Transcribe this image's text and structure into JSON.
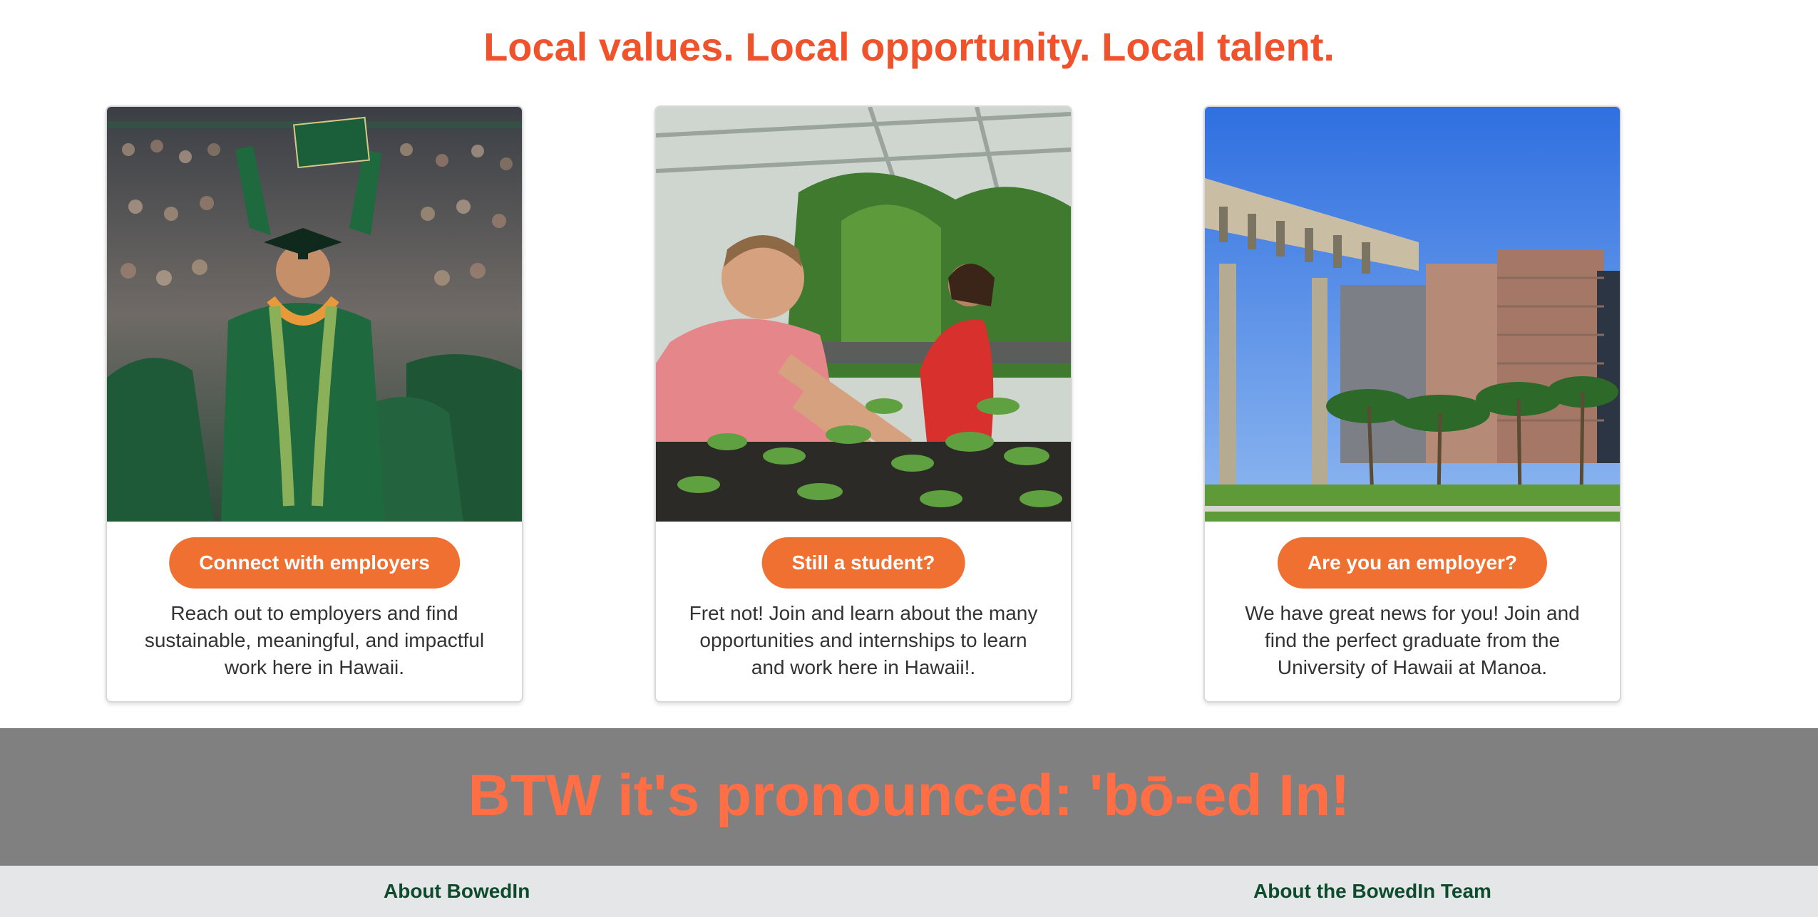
{
  "headline": "Local values. Local opportunity. Local talent.",
  "cards": [
    {
      "image_name": "graduation-photo",
      "button": "Connect with employers",
      "text": "Reach out to employers and find sustainable, meaningful, and impactful work here in Hawaii."
    },
    {
      "image_name": "greenhouse-research-photo",
      "button": "Still a student?",
      "text": "Fret not! Join and learn about the many opportunities and internships to learn and work here in Hawaii!."
    },
    {
      "image_name": "honolulu-buildings-photo",
      "button": "Are you an employer?",
      "text": "We have great news for you! Join and find the perfect graduate from the University of Hawaii at Manoa."
    }
  ],
  "banner": {
    "text": "BTW it's pronounced: 'bō-ed In!"
  },
  "footer": {
    "about": "About BowedIn",
    "team": "About the BowedIn Team"
  },
  "colors": {
    "accent": "#ef7031",
    "headline": "#f0532c",
    "banner_bg": "#808080",
    "banner_text": "#ff6e45",
    "footer_bg": "#e5e6e8",
    "footer_link": "#0e4a2c"
  }
}
